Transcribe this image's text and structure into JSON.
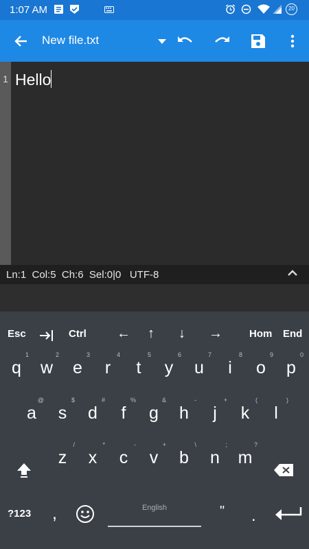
{
  "status": {
    "time": "1:07 AM",
    "battery": "20"
  },
  "toolbar": {
    "file_name": "New file.txt"
  },
  "editor": {
    "line_number": "1",
    "text": "Hello"
  },
  "info": {
    "text": "Ln:1  Col:5  Ch:6  Sel:0|0   UTF-8"
  },
  "keyboard": {
    "controls": {
      "esc": "Esc",
      "ctrl": "Ctrl",
      "left": "←",
      "up": "↑",
      "down": "↓",
      "right": "→",
      "home": "Hom",
      "end": "End"
    },
    "row1": [
      {
        "k": "q",
        "h": "1"
      },
      {
        "k": "w",
        "h": "2"
      },
      {
        "k": "e",
        "h": "3"
      },
      {
        "k": "r",
        "h": "4"
      },
      {
        "k": "t",
        "h": "5"
      },
      {
        "k": "y",
        "h": "6"
      },
      {
        "k": "u",
        "h": "7"
      },
      {
        "k": "i",
        "h": "8"
      },
      {
        "k": "o",
        "h": "9"
      },
      {
        "k": "p",
        "h": "0"
      }
    ],
    "row2": [
      {
        "k": "a",
        "h": "@"
      },
      {
        "k": "s",
        "h": "$"
      },
      {
        "k": "d",
        "h": "#"
      },
      {
        "k": "f",
        "h": "%"
      },
      {
        "k": "g",
        "h": "&"
      },
      {
        "k": "h",
        "h": "-"
      },
      {
        "k": "j",
        "h": "+"
      },
      {
        "k": "k",
        "h": "("
      },
      {
        "k": "l",
        "h": ")"
      }
    ],
    "row3": [
      {
        "k": "z",
        "h": "/"
      },
      {
        "k": "x",
        "h": "*"
      },
      {
        "k": "c",
        "h": "-"
      },
      {
        "k": "v",
        "h": "+"
      },
      {
        "k": "b",
        "h": "\\"
      },
      {
        "k": "n",
        "h": ";"
      },
      {
        "k": "m",
        "h": "?"
      }
    ],
    "sym": "?123",
    "comma": ",",
    "space_label": "English",
    "quote": "\"",
    "period": "."
  }
}
